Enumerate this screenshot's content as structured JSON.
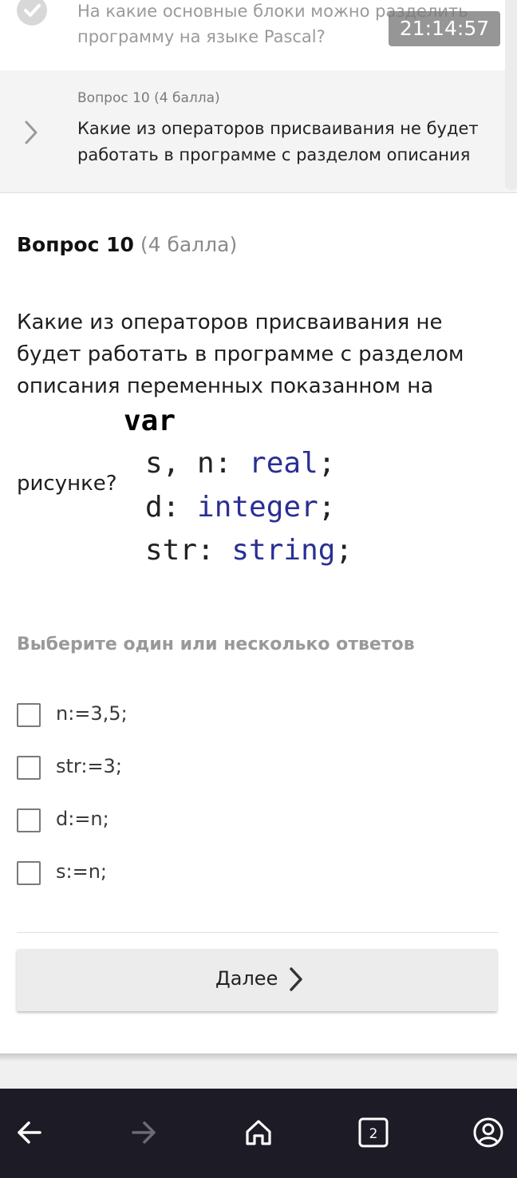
{
  "top_list": {
    "prev_item_text": "На какие основные блоки можно разделить программу на языке Pascal?",
    "timer": "21:14:57",
    "current_item": {
      "label": "Вопрос 10 (4 балла)",
      "text": "Какие из операторов присваивания не будет работать в программе с разделом описания"
    }
  },
  "question": {
    "title_bold": "Вопрос 10",
    "title_points": "(4 балла)",
    "text": "Какие из операторов присваивания не будет работать в программе с разделом описания переменных показанном на",
    "text_end": "рисунке?",
    "code": {
      "var": "var",
      "line1_prefix": "s, n: ",
      "line1_type": "real",
      "line1_suffix": ";",
      "line2_prefix": "d: ",
      "line2_type": "integer",
      "line2_suffix": ";",
      "line3_prefix": "str: ",
      "line3_type": "string",
      "line3_suffix": ";"
    },
    "instruction": "Выберите один или несколько ответов",
    "options": [
      {
        "label": "n:=3,5;",
        "checked": false
      },
      {
        "label": "str:=3;",
        "checked": false
      },
      {
        "label": "d:=n;",
        "checked": false
      },
      {
        "label": "s:=n;",
        "checked": false
      }
    ]
  },
  "next_button": {
    "label": "Далее"
  },
  "navbar": {
    "tabs_count": "2",
    "icons": [
      "back-arrow-icon",
      "forward-arrow-icon",
      "home-icon",
      "tabs-icon",
      "account-icon"
    ]
  },
  "colors": {
    "navbar_bg": "#1d1c26",
    "code_keyword": "#2a2f93",
    "button_bg": "#ececec"
  }
}
